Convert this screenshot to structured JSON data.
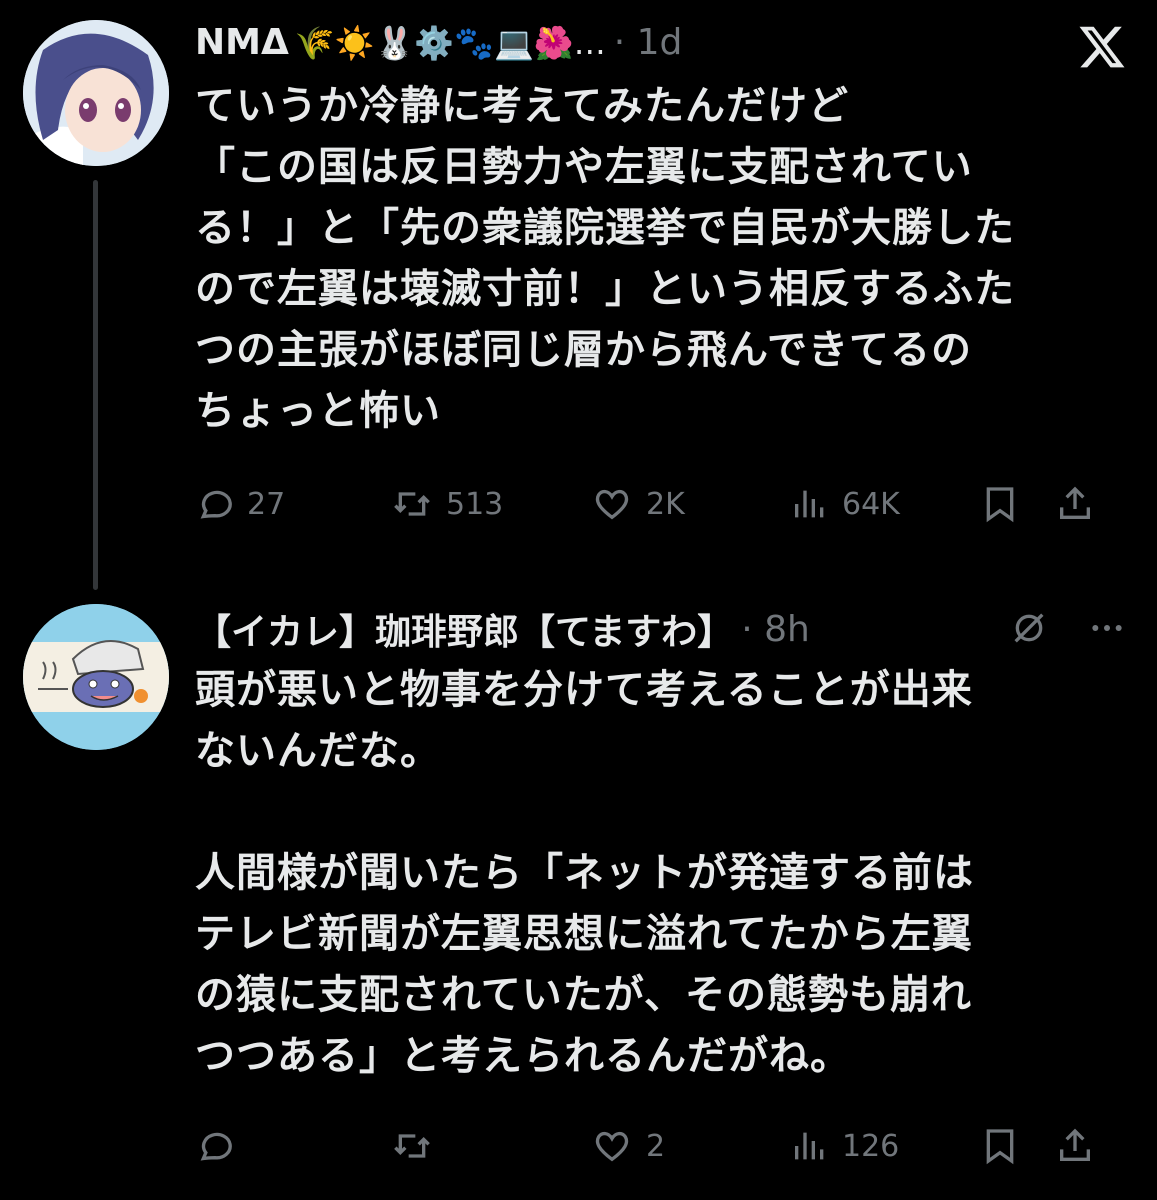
{
  "tweet1": {
    "author_name": "NMΔ",
    "emojis": "🌾☀️🐰⚙️🐾💻🌺…",
    "time": "· 1d",
    "text": "ていうか冷静に考えてみたんだけど\n「この国は反日勢力や左翼に支配されてい\nる！」と「先の衆議院選挙で自民が大勝した\nので左翼は壊滅寸前！」という相反するふた\nつの主張がほぼ同じ層から飛んできてるの\nちょっと怖い",
    "replies": "27",
    "reposts": "513",
    "likes": "2K",
    "views": "64K"
  },
  "tweet2": {
    "author_name": "【イカレ】珈琲野郎【てますわ】",
    "time": "· 8h",
    "text": "頭が悪いと物事を分けて考えることが出来\nないんだな。\n\n人間様が聞いたら「ネットが発達する前は\nテレビ新聞が左翼思想に溢れてたから左翼\nの猿に支配されていたが、その態勢も崩れ\nつつある」と考えられるんだがね。",
    "replies": "",
    "reposts": "",
    "likes": "2",
    "views": "126"
  },
  "icons": {
    "reply": "reply-icon",
    "repost": "repost-icon",
    "like": "heart-icon",
    "views": "views-icon",
    "bookmark": "bookmark-icon",
    "share": "share-icon",
    "x_logo": "x-logo-icon",
    "grok": "grok-icon",
    "more": "more-icon"
  },
  "colors": {
    "background": "#000000",
    "text": "#e7e9ea",
    "muted": "#71767b",
    "thread_line": "#333639"
  }
}
